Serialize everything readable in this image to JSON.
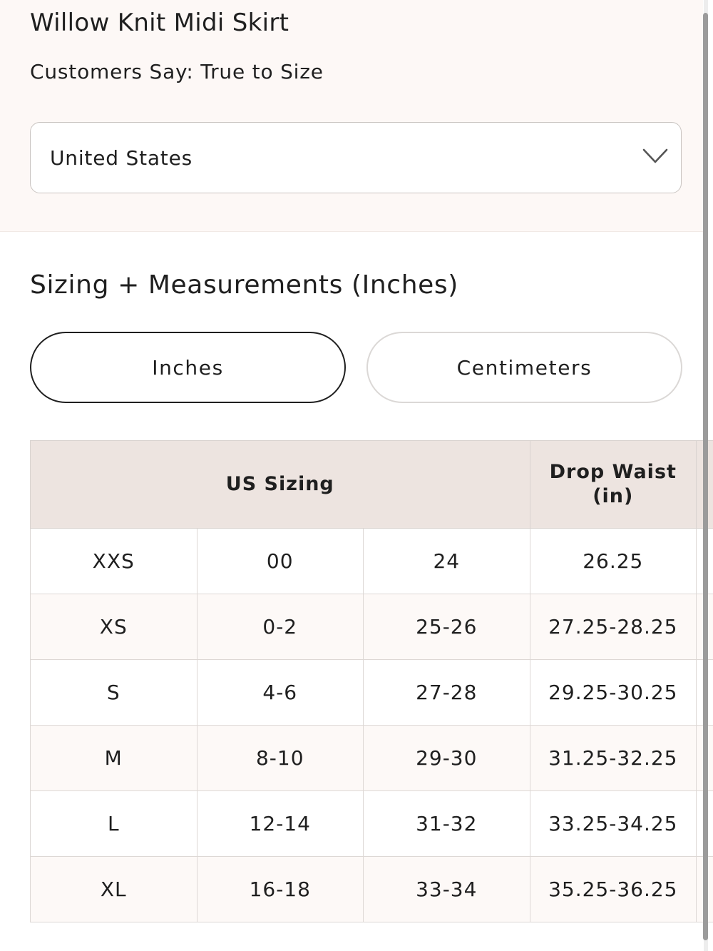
{
  "product": {
    "title": "Willow Knit Midi Skirt",
    "fit_note": "Customers Say: True to Size"
  },
  "country_select": {
    "value": "United States",
    "icon": "chevron-down-icon"
  },
  "sizing": {
    "title": "Sizing + Measurements (Inches)",
    "units": [
      {
        "label": "Inches",
        "active": true
      },
      {
        "label": "Centimeters",
        "active": false
      }
    ],
    "headers": {
      "us_sizing": "US Sizing",
      "drop_waist": "Drop Waist (in)"
    },
    "rows": [
      [
        "XXS",
        "00",
        "24",
        "26.25"
      ],
      [
        "XS",
        "0-2",
        "25-26",
        "27.25-28.25"
      ],
      [
        "S",
        "4-6",
        "27-28",
        "29.25-30.25"
      ],
      [
        "M",
        "8-10",
        "29-30",
        "31.25-32.25"
      ],
      [
        "L",
        "12-14",
        "31-32",
        "33.25-34.25"
      ],
      [
        "XL",
        "16-18",
        "33-34",
        "35.25-36.25"
      ]
    ]
  },
  "colors": {
    "top_background": "#fdf8f6",
    "header_background": "#ede4e0",
    "text": "#1f1f1f"
  }
}
